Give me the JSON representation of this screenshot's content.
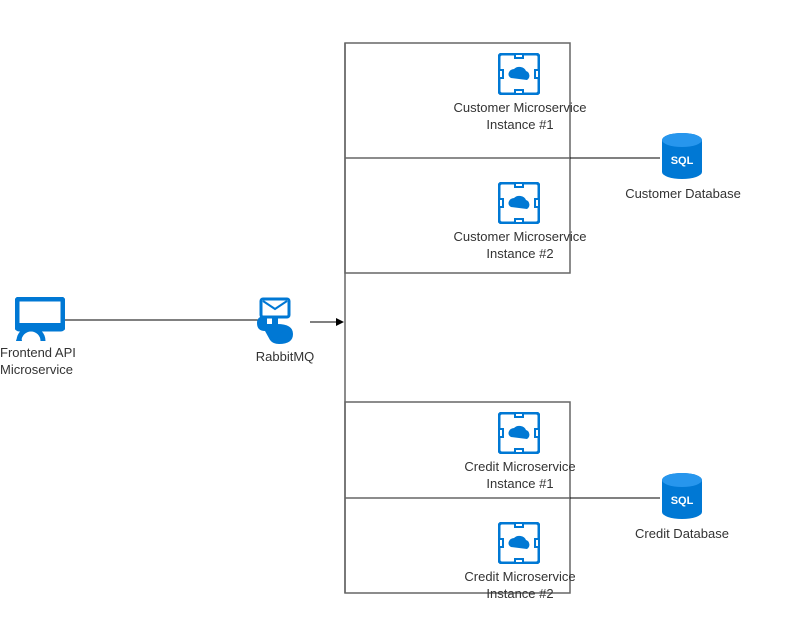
{
  "colors": {
    "azure": "#0078D4",
    "line": "#666666"
  },
  "nodes": {
    "frontend": {
      "label": "Frontend API\nMicroservice"
    },
    "rabbitmq": {
      "label": "RabbitMQ"
    },
    "cust1": {
      "label": "Customer Microservice\nInstance #1"
    },
    "cust2": {
      "label": "Customer Microservice\nInstance #2"
    },
    "custdb": {
      "label": "Customer Database"
    },
    "cred1": {
      "label": "Credit Microservice\nInstance #1"
    },
    "cred2": {
      "label": "Credit Microservice\nInstance #2"
    },
    "creddb": {
      "label": "Credit Database"
    }
  }
}
